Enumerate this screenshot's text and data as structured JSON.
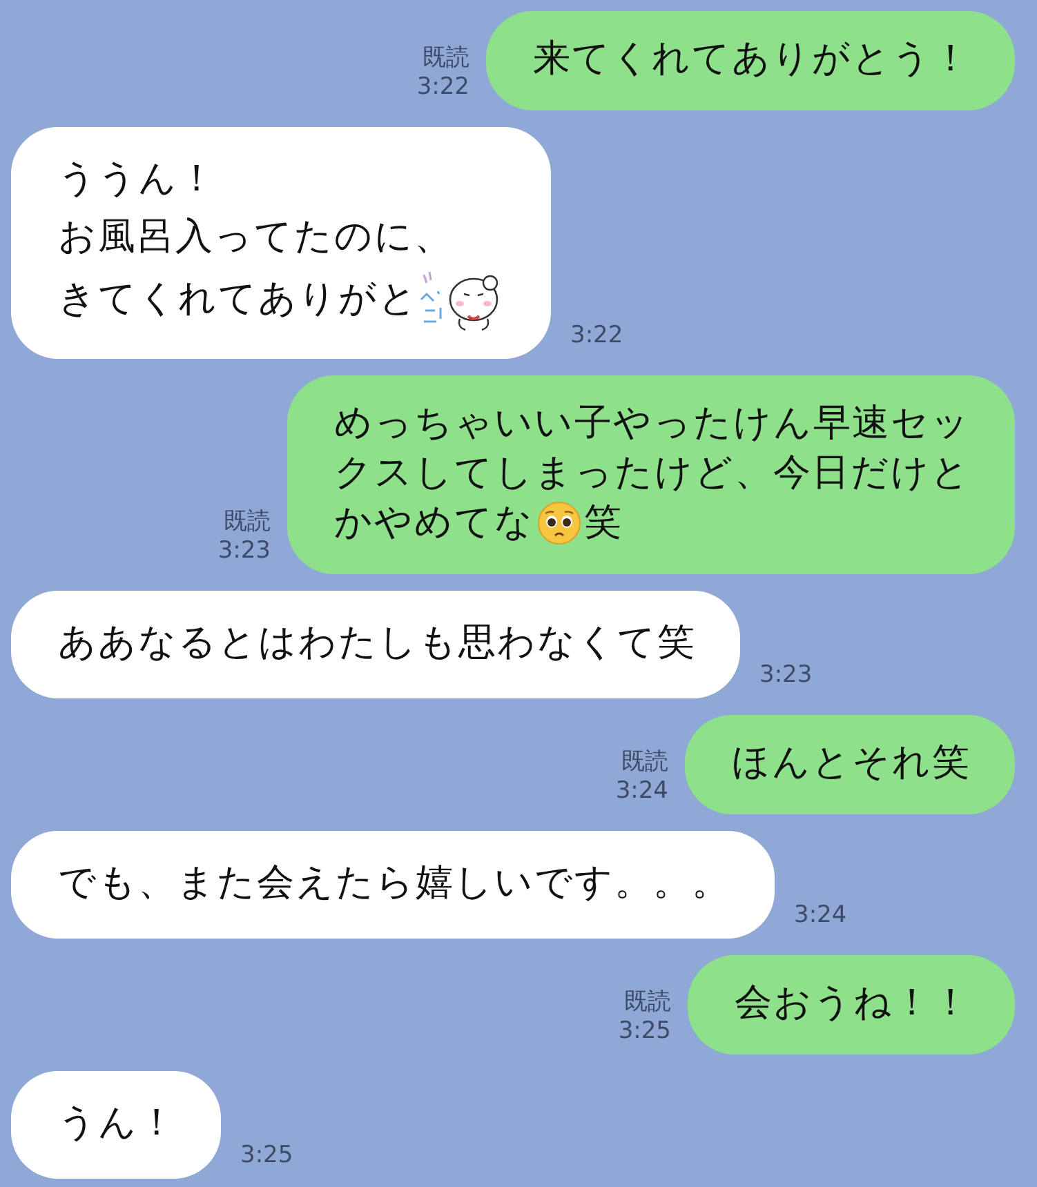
{
  "messages": [
    {
      "kind": "outgoing",
      "read": "既読",
      "time": "3:22",
      "lines": [
        [
          {
            "kind": "text",
            "text": "来てくれてありがとう！"
          }
        ]
      ]
    },
    {
      "kind": "incoming",
      "time": "3:22",
      "lines": [
        [
          {
            "kind": "text",
            "text": "ううん！"
          }
        ],
        [
          {
            "kind": "text",
            "text": "お風呂入ってたのに、"
          }
        ],
        [
          {
            "kind": "text",
            "text": "きてくれてありがと"
          },
          {
            "kind": "sticker"
          }
        ]
      ]
    },
    {
      "kind": "outgoing",
      "read": "既読",
      "time": "3:23",
      "lines": [
        [
          {
            "kind": "text",
            "text": "めっちゃいい子やったけん早速セッ"
          }
        ],
        [
          {
            "kind": "text",
            "text": "クスしてしまったけど、今日だけと"
          }
        ],
        [
          {
            "kind": "text",
            "text": "かやめてな"
          },
          {
            "kind": "emoji"
          },
          {
            "kind": "text",
            "text": "笑"
          }
        ]
      ]
    },
    {
      "kind": "incoming",
      "time": "3:23",
      "lines": [
        [
          {
            "kind": "text",
            "text": "ああなるとはわたしも思わなくて笑"
          }
        ]
      ]
    },
    {
      "kind": "outgoing",
      "read": "既読",
      "time": "3:24",
      "lines": [
        [
          {
            "kind": "text",
            "text": "ほんとそれ笑"
          }
        ]
      ]
    },
    {
      "kind": "incoming",
      "time": "3:24",
      "lines": [
        [
          {
            "kind": "text",
            "text": "でも、また会えたら嬉しいです。。。"
          }
        ]
      ]
    },
    {
      "kind": "outgoing",
      "read": "既読",
      "time": "3:25",
      "lines": [
        [
          {
            "kind": "text",
            "text": "会おうね！！"
          }
        ]
      ]
    },
    {
      "kind": "incoming",
      "time": "3:25",
      "lines": [
        [
          {
            "kind": "text",
            "text": "うん！"
          }
        ]
      ]
    }
  ]
}
